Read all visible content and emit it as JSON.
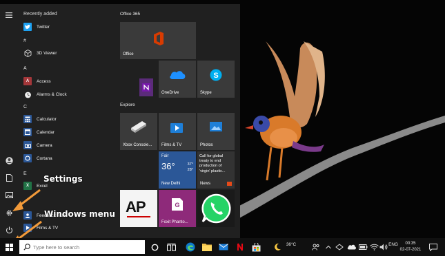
{
  "start_menu": {
    "sections": {
      "recently_added": "Recently added",
      "hash": "#",
      "a": "A",
      "c": "C",
      "e": "E"
    },
    "apps": {
      "twitter": "Twitter",
      "viewer3d": "3D Viewer",
      "access": "Access",
      "alarms": "Alarms & Clock",
      "calculator": "Calculator",
      "calendar": "Calendar",
      "camera": "Camera",
      "cortana": "Cortana",
      "excel": "Excel",
      "feedback": "Feedback Hub",
      "films": "Films & TV"
    },
    "tiles": {
      "group_office": "Office 365",
      "office": "Office",
      "onedrive": "OneDrive",
      "skype": "Skype",
      "group_explore": "Explore",
      "xbox": "Xbox Console...",
      "films": "Films & TV",
      "photos": "Photos",
      "weather_cond": "Fair",
      "weather_temp": "36°",
      "weather_hi": "37°",
      "weather_lo": "28°",
      "weather_city": "New Delhi",
      "news_text": "Call for global treaty to end production of 'virgin' plastic...",
      "news_label": "News",
      "ap_logo": "AP",
      "foxit": "Foxit Phanto..."
    }
  },
  "annotations": {
    "settings": "Settings",
    "windows_menu": "Windows menu"
  },
  "taskbar": {
    "search_placeholder": "Type here to search",
    "weather": "36°C",
    "language": "ENG",
    "time": "00:35",
    "date": "02-07-2021"
  },
  "colors": {
    "accent": "#0078d7",
    "start_bg": "#202020",
    "tile_blue": "#2b5797",
    "annotation_arrow": "#f29a3a"
  }
}
